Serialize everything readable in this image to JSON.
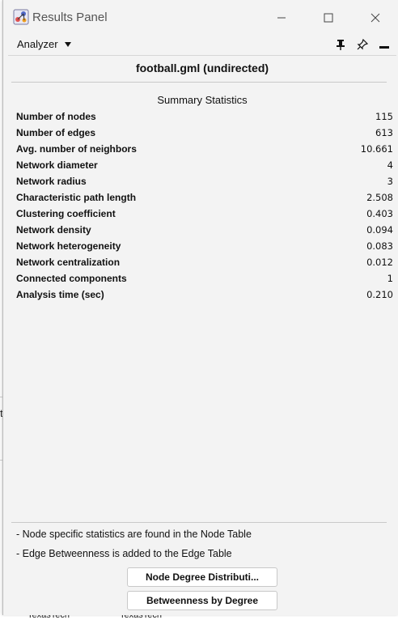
{
  "window": {
    "title": "Results Panel",
    "app_icon": "cytoscape-icon"
  },
  "toolbar": {
    "analyzer_label": "Analyzer",
    "analyzer_dropdown_icon": "dropdown-arrow-icon",
    "icons": [
      "pin-icon",
      "float-icon",
      "minimize-panel-icon"
    ]
  },
  "content": {
    "file_title": "football.gml (undirected)",
    "section_title": "Summary Statistics",
    "stats": [
      {
        "label": "Number of nodes",
        "value": "115"
      },
      {
        "label": "Number of edges",
        "value": "613"
      },
      {
        "label": "Avg. number of neighbors",
        "value": "10.661"
      },
      {
        "label": "Network diameter",
        "value": "4"
      },
      {
        "label": "Network radius",
        "value": "3"
      },
      {
        "label": "Characteristic path length",
        "value": "2.508"
      },
      {
        "label": "Clustering coefficient",
        "value": "0.403"
      },
      {
        "label": "Network density",
        "value": "0.094"
      },
      {
        "label": "Network heterogeneity",
        "value": "0.083"
      },
      {
        "label": "Network centralization",
        "value": "0.012"
      },
      {
        "label": "Connected components",
        "value": "1"
      },
      {
        "label": "Analysis time (sec)",
        "value": "0.210"
      }
    ],
    "notes": [
      "- Node specific statistics are found in the Node Table",
      "- Edge Betweenness is added to the Edge Table"
    ],
    "buttons": {
      "degree_dist": "Node Degree Distributi...",
      "betweenness": "Betweenness by Degree"
    }
  },
  "background": {
    "fragment_left": "t",
    "fragment_bottom_1": "TexasTech",
    "fragment_bottom_2": "TexasTech"
  }
}
